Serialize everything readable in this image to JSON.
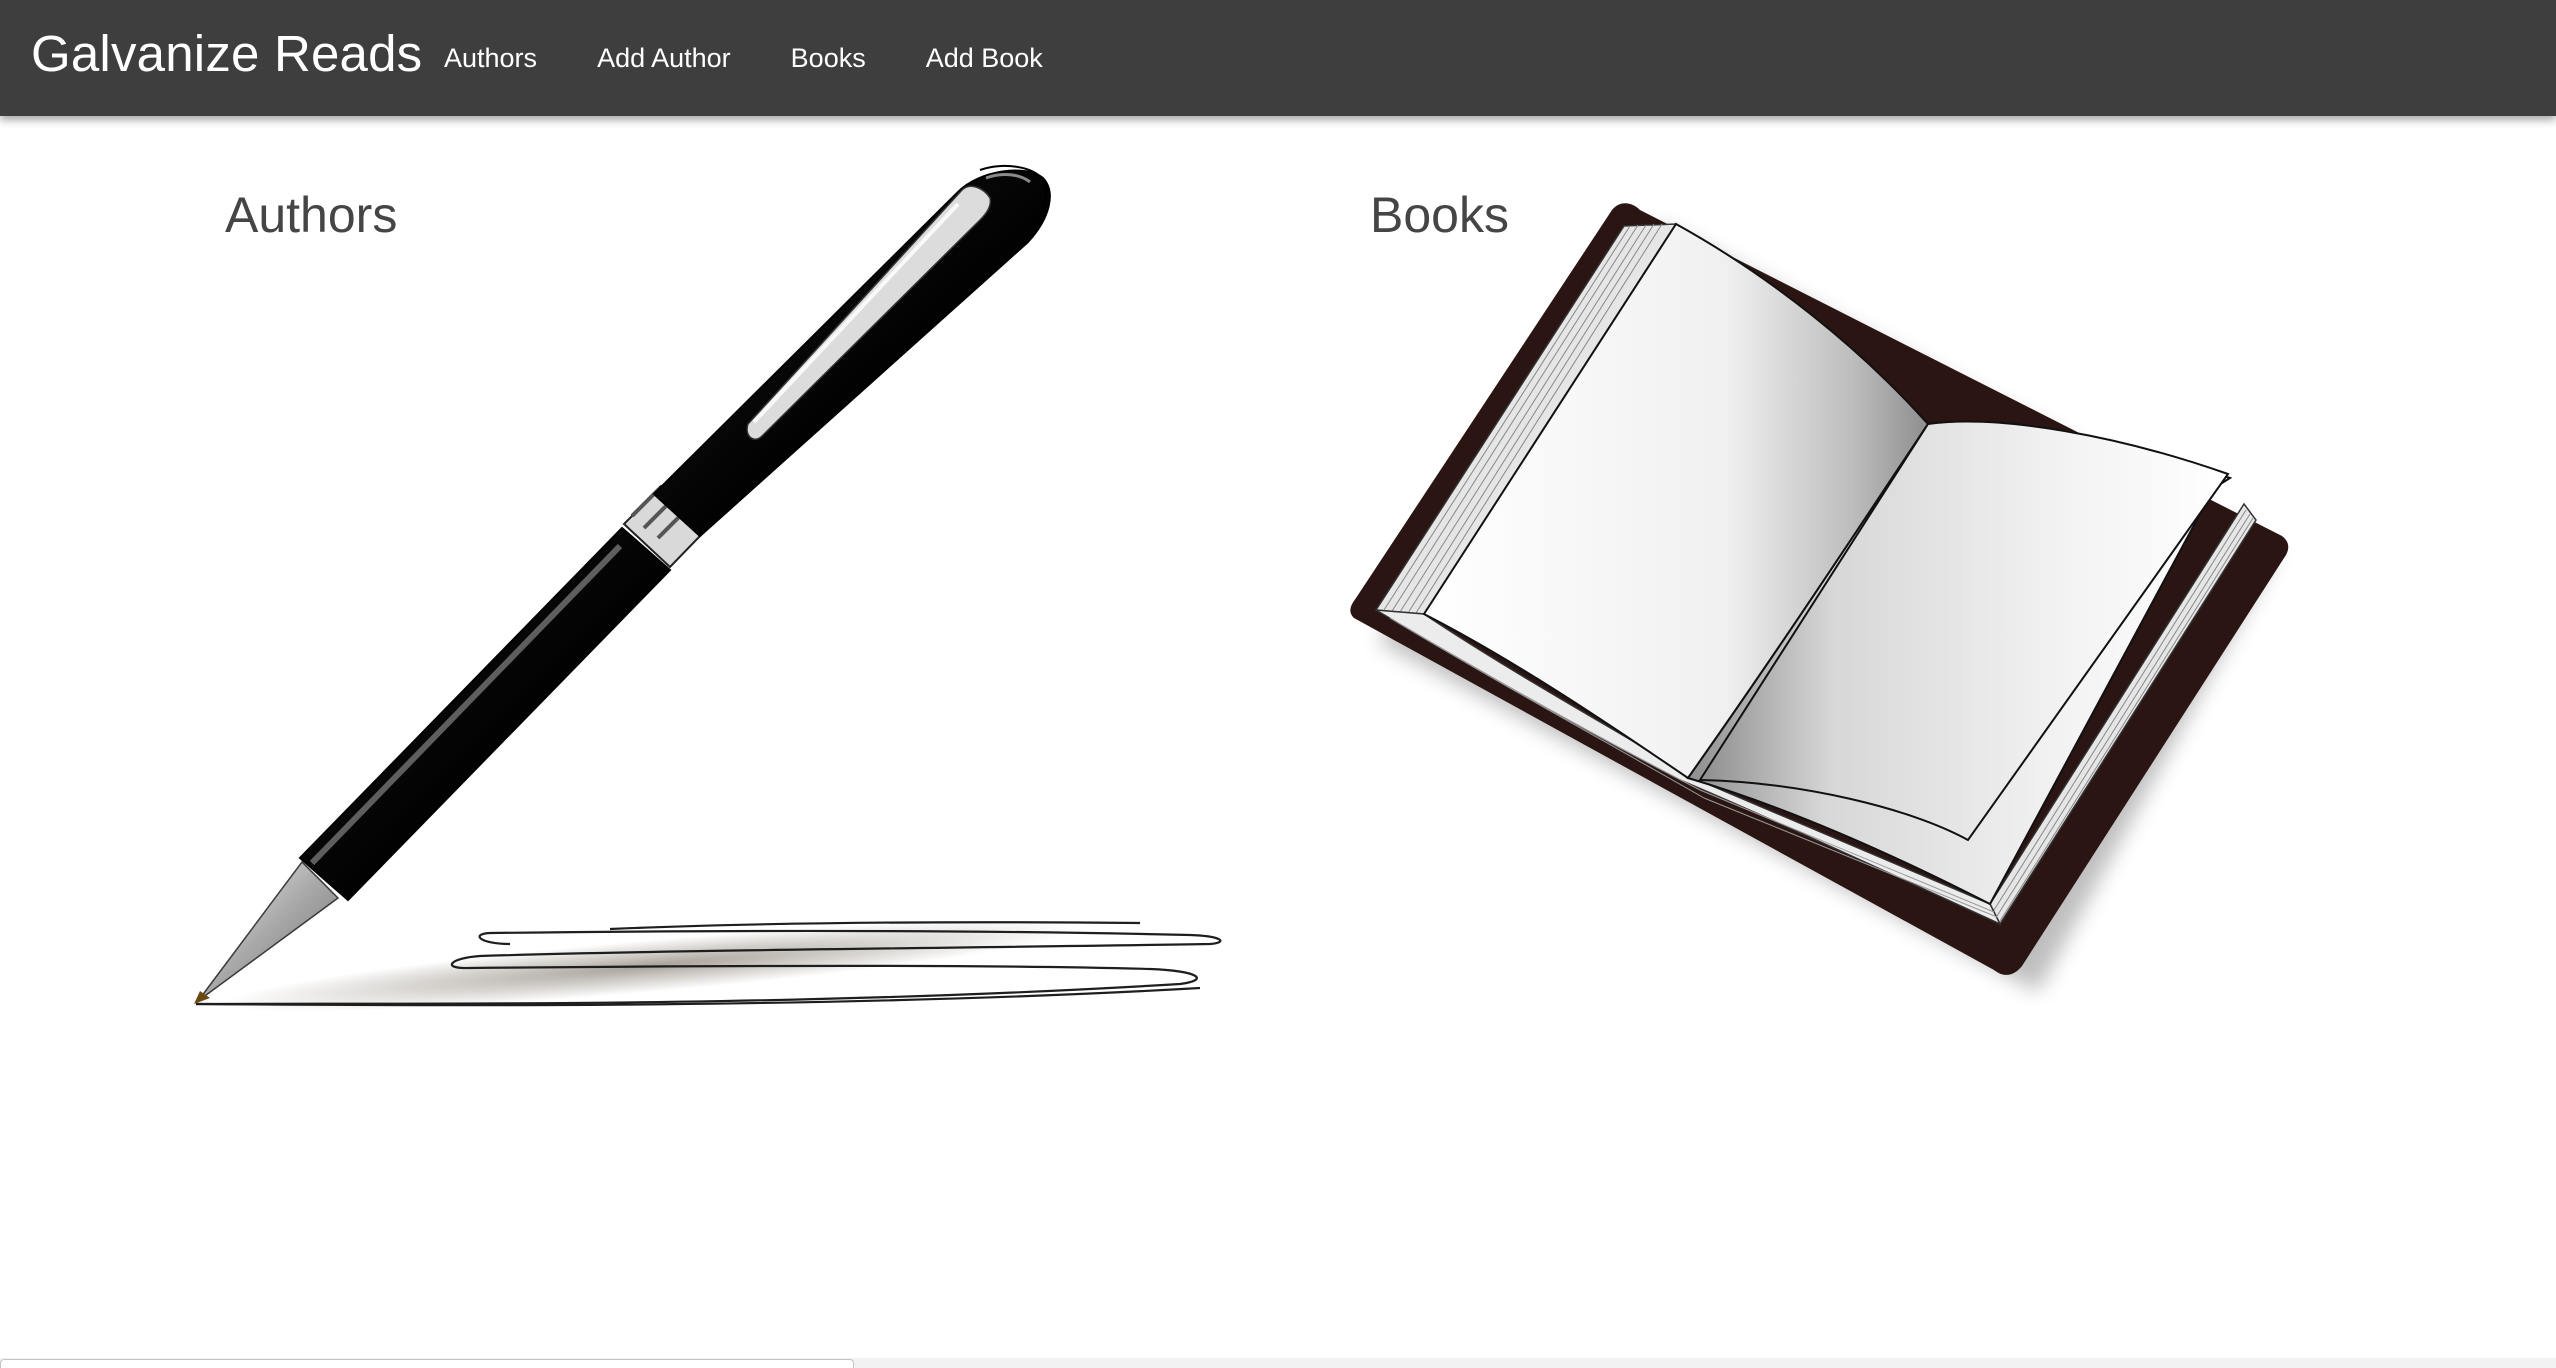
{
  "navbar": {
    "brand": "Galvanize Reads",
    "links": [
      "Authors",
      "Add Author",
      "Books",
      "Add Book"
    ]
  },
  "cards": {
    "authors": {
      "title": "Authors",
      "illustration": "pen-writing-illustration"
    },
    "books": {
      "title": "Books",
      "illustration": "open-book-illustration"
    }
  },
  "colors": {
    "navbar_bg": "#3e3e3e",
    "nav_text": "#ffffff",
    "heading_text": "#454545",
    "book_cover": "#2a1512"
  }
}
